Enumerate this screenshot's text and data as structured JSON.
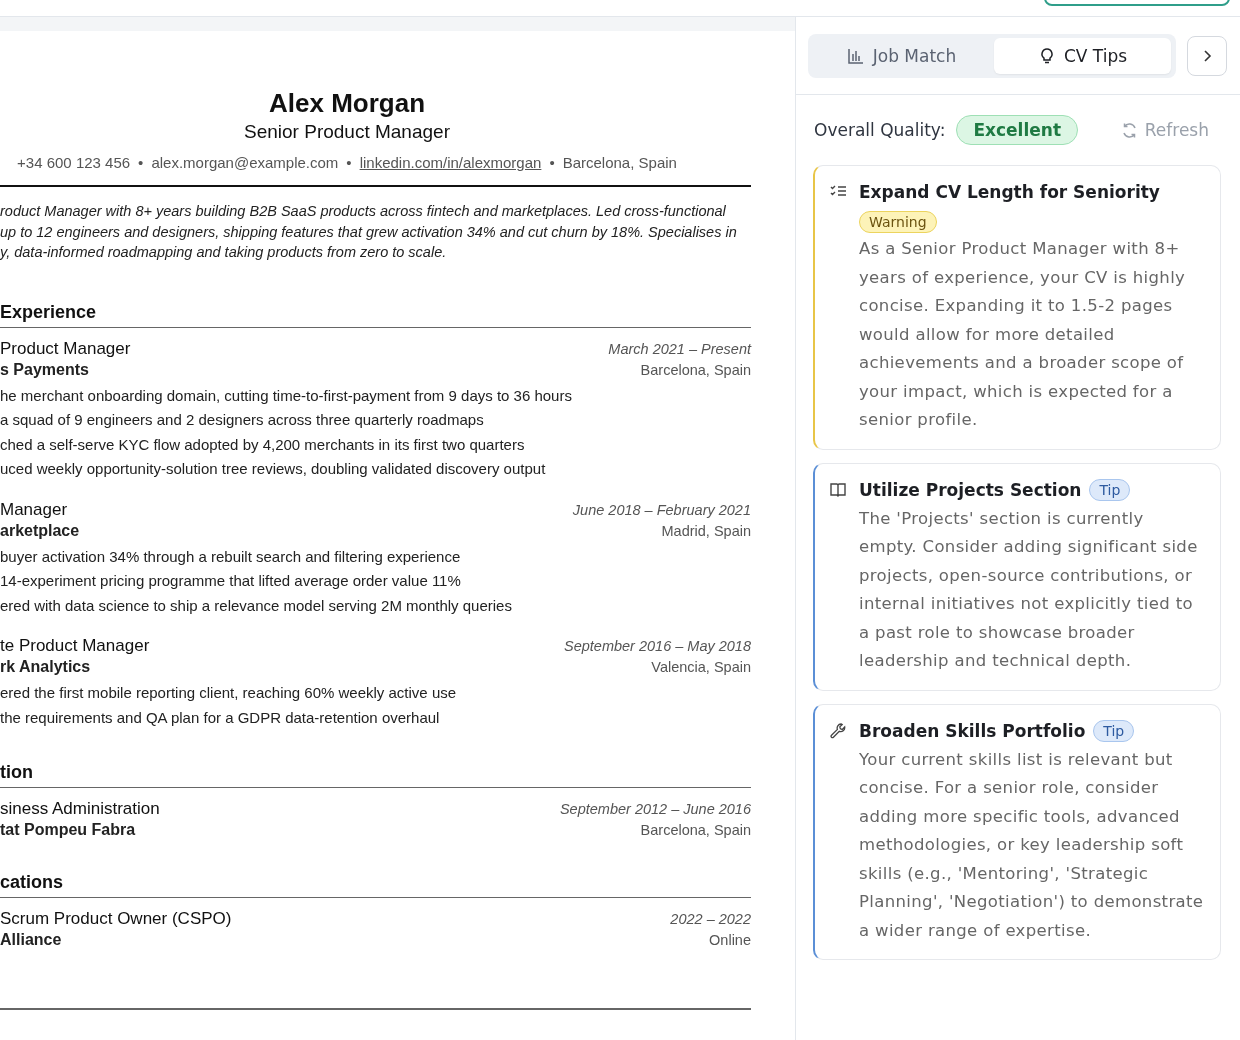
{
  "resume": {
    "name": "Alex Morgan",
    "headline": "Senior Product Manager",
    "contact": [
      {
        "text": "+34 600 123 456",
        "kind": "text"
      },
      {
        "text": "alex.morgan@example.com",
        "kind": "text"
      },
      {
        "text": "linkedin.com/in/alexmorgan",
        "kind": "link"
      },
      {
        "text": "Barcelona, Spain",
        "kind": "text"
      }
    ],
    "separator": "•",
    "summary_lines": [
      "roduct Manager with 8+ years building B2B SaaS products across fintech and marketplaces. Led cross-functional",
      "up to 12 engineers and designers, shipping features that grew activation 34% and cut churn by 18%. Specialises in",
      "y, data-informed roadmapping and taking products from zero to scale."
    ],
    "sections": [
      {
        "heading": "Experience",
        "entries": [
          {
            "title": "Product Manager",
            "organization": "s Payments",
            "dates": "March 2021 – Present",
            "location": "Barcelona, Spain",
            "bullets": [
              "he merchant onboarding domain, cutting time-to-first-payment from 9 days to 36 hours",
              "a squad of 9 engineers and 2 designers across three quarterly roadmaps",
              "ched a self-serve KYC flow adopted by 4,200 merchants in its first two quarters",
              "uced weekly opportunity-solution tree reviews, doubling validated discovery output"
            ]
          },
          {
            "title": "Manager",
            "organization": "arketplace",
            "dates": "June 2018 – February 2021",
            "location": "Madrid, Spain",
            "bullets": [
              "buyer activation 34% through a rebuilt search and filtering experience",
              "14-experiment pricing programme that lifted average order value 11%",
              "ered with data science to ship a relevance model serving 2M monthly queries"
            ]
          },
          {
            "title": "te Product Manager",
            "organization": "rk Analytics",
            "dates": "September 2016 – May 2018",
            "location": "Valencia, Spain",
            "bullets": [
              "ered the first mobile reporting client, reaching 60% weekly active use",
              "the requirements and QA plan for a GDPR data-retention overhaul"
            ]
          }
        ]
      },
      {
        "heading": "tion",
        "entries": [
          {
            "title": "siness Administration",
            "organization": "tat Pompeu Fabra",
            "dates": "September 2012 – June 2016",
            "location": "Barcelona, Spain"
          }
        ]
      },
      {
        "heading": "cations",
        "entries": [
          {
            "title": "Scrum Product Owner (CSPO)",
            "organization": "Alliance",
            "dates": "2022 – 2022",
            "location": "Online"
          }
        ]
      }
    ]
  },
  "panel": {
    "tabs": [
      {
        "label": "Job Match",
        "selected": false
      },
      {
        "label": "CV Tips",
        "selected": true
      }
    ],
    "quality_label": "Overall Quality:",
    "quality_rating": "Excellent",
    "refresh": "Refresh",
    "tips": [
      {
        "title": "Expand CV Length for Seniority",
        "kind": "warning",
        "badge": "Warning",
        "body": "As a Senior Product Manager with 8+ years of experience, your CV is highly concise. Expanding it to 1.5-2 pages would allow for more detailed achievements and a broader scope of your impact, which is expected for a senior profile."
      },
      {
        "title": "Utilize Projects Section",
        "kind": "tip",
        "badge": "Tip",
        "body": "The 'Projects' section is currently empty. Consider adding significant side projects, open-source contributions, or internal initiatives not explicitly tied to a past role to showcase broader leadership and technical depth."
      },
      {
        "title": "Broaden Skills Portfolio",
        "kind": "tip",
        "badge": "Tip",
        "body": "Your current skills list is relevant but concise. For a senior role, consider adding more specific tools, advanced methodologies, or key leadership soft skills (e.g., 'Mentoring', 'Strategic Planning', 'Negotiation') to demonstrate a wider range of expertise."
      }
    ]
  }
}
